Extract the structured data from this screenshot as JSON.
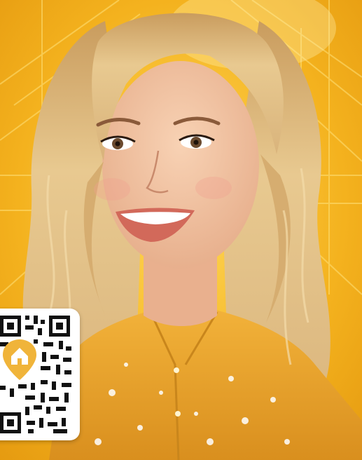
{
  "scene": {
    "subject": "portrait-woman",
    "background_color": "#f4b21e",
    "highlight_color": "#ffe27a",
    "hair_color": "#e2bf82",
    "skin_color": "#f0c2a0",
    "shirt_color": "#e9a62e",
    "lip_color": "#d2695a"
  },
  "qr_badge": {
    "icon": "house-location-pin-icon",
    "pin_color": "#f0b43a"
  }
}
